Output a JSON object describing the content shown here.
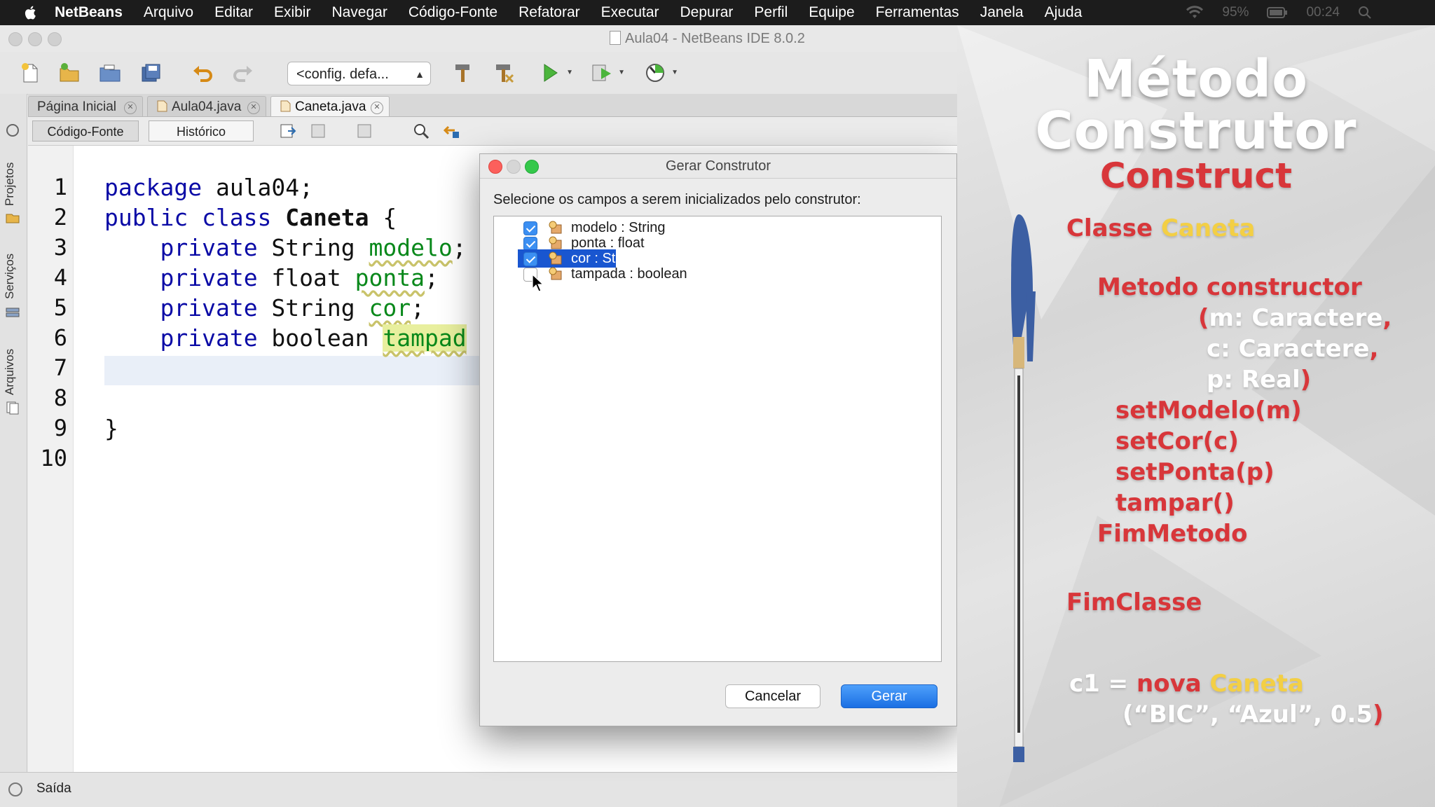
{
  "menubar": {
    "app": "NetBeans",
    "items": [
      "Arquivo",
      "Editar",
      "Exibir",
      "Navegar",
      "Código-Fonte",
      "Refatorar",
      "Executar",
      "Depurar",
      "Perfil",
      "Equipe",
      "Ferramentas",
      "Janela",
      "Ajuda"
    ],
    "battery": "95%",
    "clock": "00:24"
  },
  "ide": {
    "title": "Aula04 - NetBeans IDE 8.0.2",
    "config_select": "<config. defa...",
    "side_panels": [
      "Projetos",
      "Serviços",
      "Arquivos"
    ],
    "tabs": [
      {
        "label": "Página Inicial"
      },
      {
        "label": "Aula04.java"
      },
      {
        "label": "Caneta.java",
        "active": true
      }
    ],
    "view_buttons": {
      "source": "Código-Fonte",
      "history": "Histórico"
    },
    "line_numbers": [
      "1",
      "2",
      "3",
      "4",
      "5",
      "6",
      "7",
      "8",
      "9",
      "10"
    ],
    "code": {
      "l1_kw": "package",
      "l1_rest": " aula04;",
      "l2_kw": "public class",
      "l2_name": "Caneta",
      "l2_rest": " {",
      "l3_kw": "private",
      "l3_type": " String ",
      "l3_field": "modelo",
      "l4_kw": "private",
      "l4_type": " float ",
      "l4_field": "ponta",
      "l5_kw": "private",
      "l5_type": " String ",
      "l5_field": "cor",
      "l6_kw": "private",
      "l6_type": " boolean ",
      "l6_field": "tampad",
      "l9": "}",
      "semicolon": ";"
    },
    "status_output": "Saída"
  },
  "dialog": {
    "title": "Gerar Construtor",
    "prompt": "Selecione os campos a serem inicializados pelo construtor:",
    "fields": [
      {
        "label": "modelo : String",
        "checked": true,
        "selected": false
      },
      {
        "label": "ponta : float",
        "checked": true,
        "selected": false
      },
      {
        "label": "cor : String",
        "checked": true,
        "selected": true
      },
      {
        "label": "tampada : boolean",
        "checked": false,
        "selected": false
      }
    ],
    "cancel_label": "Cancelar",
    "generate_label": "Gerar"
  },
  "slide": {
    "title_line1": "Método",
    "title_line2": "Construtor",
    "subtitle": "Construct",
    "classe_kw": "Classe",
    "classe_name": "Caneta",
    "metodo_kw": "Metodo",
    "metodo_name": "constructor",
    "param_open": "(",
    "p1": "m: Caractere",
    "p2": "c: Caractere",
    "p3": "p: Real",
    "comma": ",",
    "param_close": ")",
    "call1": "setModelo(m)",
    "call2": "setCor(c)",
    "call3": "setPonta(p)",
    "call4": "tampar()",
    "fim_metodo": "FimMetodo",
    "fim_classe": "FimClasse",
    "inst_var": "c1",
    "inst_eq": "=",
    "inst_nova": "nova",
    "inst_class": "Caneta",
    "inst_args": "(“BIC”, “Azul”, 0.5",
    "inst_close": ")"
  },
  "colors": {
    "keyword": "#0a0aa6",
    "field": "#08881a",
    "accent_blue": "#1956d0",
    "slide_red": "#d8363a",
    "slide_yellow": "#f3cf45"
  }
}
